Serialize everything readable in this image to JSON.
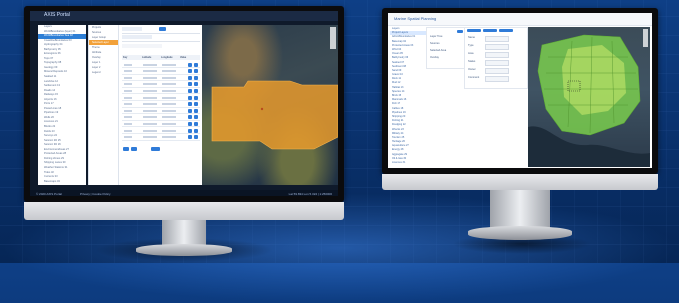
{
  "left_monitor": {
    "title": "AXIS Portal",
    "sidebar_items": [
      "Layers",
      "WorldBoundaries (layer) 01",
      "WorldBoundaries Sea 02",
      "CoastlineBoundaries 03",
      "Hydrography 04",
      "Bathymetry 05",
      "Ecoregions 06",
      "Topo 07",
      "Topography 08",
      "Geology 09",
      "Mineral Deposits 10",
      "Seabed 11",
      "LandUse 12",
      "Settlement 13",
      "Roads 14",
      "Railways 15",
      "Airports 16",
      "Ports 17",
      "PowerLines 18",
      "Pipelines 19",
      "Wells 20",
      "Licences 21",
      "Blocks 22",
      "Fields 23",
      "Surveys 24",
      "Seismic 2D 25",
      "Seismic 3D 26",
      "EnvironmentAreas 27",
      "Protected Areas 28",
      "Fishing Zones 29",
      "Shipping Lanes 30",
      "Weather Stations 31",
      "Tides 32",
      "Currents 33",
      "Basemaps 34"
    ],
    "panel_items": [
      "Projects",
      "Sources",
      "Layer Group",
      "Selected Layer",
      "Theme",
      "Attribute",
      "Overlay",
      "Layer 1",
      "Layer 2",
      "Legend"
    ],
    "table_header": [
      "Key",
      "Latitude",
      "Longitude",
      "Value"
    ],
    "status_left": "© 2020 AXIS Portal",
    "status_mid": "Privacy | Cookie Policy",
    "status_right": "Lat 59.834 Lon 5.324 | 1:250000"
  },
  "right_monitor": {
    "title": "Marine Spatial Planning",
    "sidebar_items": [
      "Layers",
      "Project Layers",
      "AdminBoundaries 01",
      "Basemap 02",
      "Protected Areas 03",
      "Wind 04",
      "Ocean 05",
      "Bathymetry 06",
      "Seabed 07",
      "Sediment 08",
      "Sand 09",
      "Gravel 10",
      "Rock 11",
      "Mud 12",
      "Habitat 13",
      "Species 14",
      "Birds 15",
      "Mammals 16",
      "Fish 17",
      "Cables 18",
      "Pipelines 19",
      "Shipping 20",
      "Fishing 21",
      "Dredging 22",
      "Wrecks 23",
      "Military 24",
      "Tourism 25",
      "Heritage 26",
      "Aquaculture 27",
      "Energy 28",
      "Aggregate 29",
      "Oil & Gas 30",
      "Licences 31"
    ],
    "panel_items": [
      "Layer Tree",
      "Sources",
      "Selected Area",
      "Overlay"
    ],
    "form_labels": [
      "Name",
      "Type",
      "Area",
      "Status",
      "Owner",
      "Comment"
    ]
  }
}
